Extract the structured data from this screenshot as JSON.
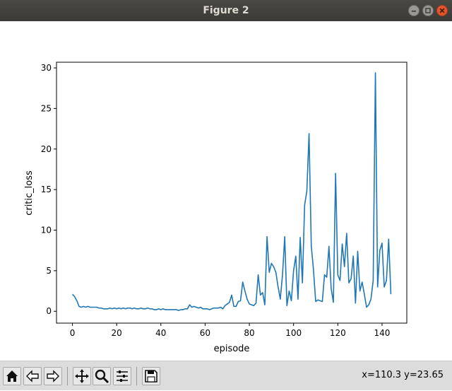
{
  "window": {
    "title": "Figure 2",
    "controls": [
      "minimize-icon",
      "maximize-icon",
      "close-icon"
    ]
  },
  "toolbar": {
    "buttons": [
      "home-icon",
      "back-icon",
      "forward-icon",
      "pan-icon",
      "zoom-icon",
      "configure-subplots-icon",
      "save-icon"
    ],
    "coords": "x=110.3 y=23.65"
  },
  "colors": {
    "line": "#1f77b4",
    "titlebar": "#3f3e3a",
    "toolbar": "#dcdcdc"
  },
  "chart_data": {
    "type": "line",
    "title": "",
    "xlabel": "episode",
    "ylabel": "critic_loss",
    "xlim": [
      -7.2,
      151.2
    ],
    "ylim": [
      -1.46,
      30.7
    ],
    "xticks": [
      0,
      20,
      40,
      60,
      80,
      100,
      120,
      140
    ],
    "yticks": [
      0,
      5,
      10,
      15,
      20,
      25,
      30
    ],
    "grid": false,
    "series": [
      {
        "x": [
          0,
          1,
          2,
          3,
          4,
          5,
          6,
          7,
          8,
          9,
          10,
          11,
          12,
          13,
          14,
          15,
          16,
          17,
          18,
          19,
          20,
          21,
          22,
          23,
          24,
          25,
          26,
          27,
          28,
          29,
          30,
          31,
          32,
          33,
          34,
          35,
          36,
          37,
          38,
          39,
          40,
          41,
          42,
          43,
          44,
          45,
          46,
          47,
          48,
          49,
          50,
          51,
          52,
          53,
          54,
          55,
          56,
          57,
          58,
          59,
          60,
          61,
          62,
          63,
          64,
          65,
          66,
          67,
          68,
          69,
          70,
          71,
          72,
          73,
          74,
          75,
          76,
          77,
          78,
          79,
          80,
          81,
          82,
          83,
          84,
          85,
          86,
          87,
          88,
          89,
          90,
          91,
          92,
          93,
          94,
          95,
          96,
          97,
          98,
          99,
          100,
          101,
          102,
          103,
          104,
          105,
          106,
          107,
          108,
          109,
          110,
          111,
          112,
          113,
          114,
          115,
          116,
          117,
          118,
          119,
          120,
          121,
          122,
          123,
          124,
          125,
          126,
          127,
          128,
          129,
          130,
          131,
          132,
          133,
          134,
          135,
          136,
          137,
          138,
          139,
          140,
          141,
          142,
          143,
          144
        ],
        "y": [
          2.1,
          1.8,
          1.3,
          0.6,
          0.5,
          0.6,
          0.5,
          0.6,
          0.5,
          0.5,
          0.5,
          0.5,
          0.4,
          0.4,
          0.3,
          0.3,
          0.3,
          0.4,
          0.3,
          0.4,
          0.3,
          0.4,
          0.3,
          0.4,
          0.3,
          0.4,
          0.4,
          0.3,
          0.4,
          0.3,
          0.3,
          0.4,
          0.3,
          0.3,
          0.4,
          0.3,
          0.3,
          0.2,
          0.2,
          0.3,
          0.2,
          0.3,
          0.2,
          0.2,
          0.2,
          0.2,
          0.2,
          0.2,
          0.1,
          0.2,
          0.2,
          0.3,
          0.3,
          0.8,
          0.5,
          0.6,
          0.5,
          0.4,
          0.5,
          0.3,
          0.3,
          0.3,
          0.2,
          0.3,
          0.4,
          0.4,
          0.4,
          0.5,
          0.3,
          0.7,
          0.9,
          1.1,
          2.0,
          0.6,
          0.6,
          1.2,
          1.3,
          3.6,
          2.5,
          1.5,
          0.9,
          0.8,
          0.7,
          1.0,
          4.5,
          2.0,
          2.3,
          0.8,
          9.2,
          4.8,
          5.9,
          5.5,
          4.8,
          3.0,
          1.5,
          4.5,
          9.2,
          0.7,
          2.5,
          1.3,
          5.0,
          6.8,
          1.5,
          9.1,
          3.5,
          13.1,
          14.8,
          21.9,
          8.1,
          5.1,
          1.2,
          1.4,
          1.3,
          1.2,
          4.5,
          4.2,
          8.0,
          2.8,
          1.1,
          17.0,
          4.5,
          3.8,
          8.3,
          5.5,
          9.6,
          3.5,
          4.0,
          6.8,
          1.0,
          7.4,
          2.5,
          3.6,
          2.1,
          0.5,
          0.8,
          1.5,
          3.8,
          29.4,
          3.0,
          7.5,
          8.4,
          3.0,
          3.8,
          8.9,
          2.1
        ]
      }
    ]
  }
}
